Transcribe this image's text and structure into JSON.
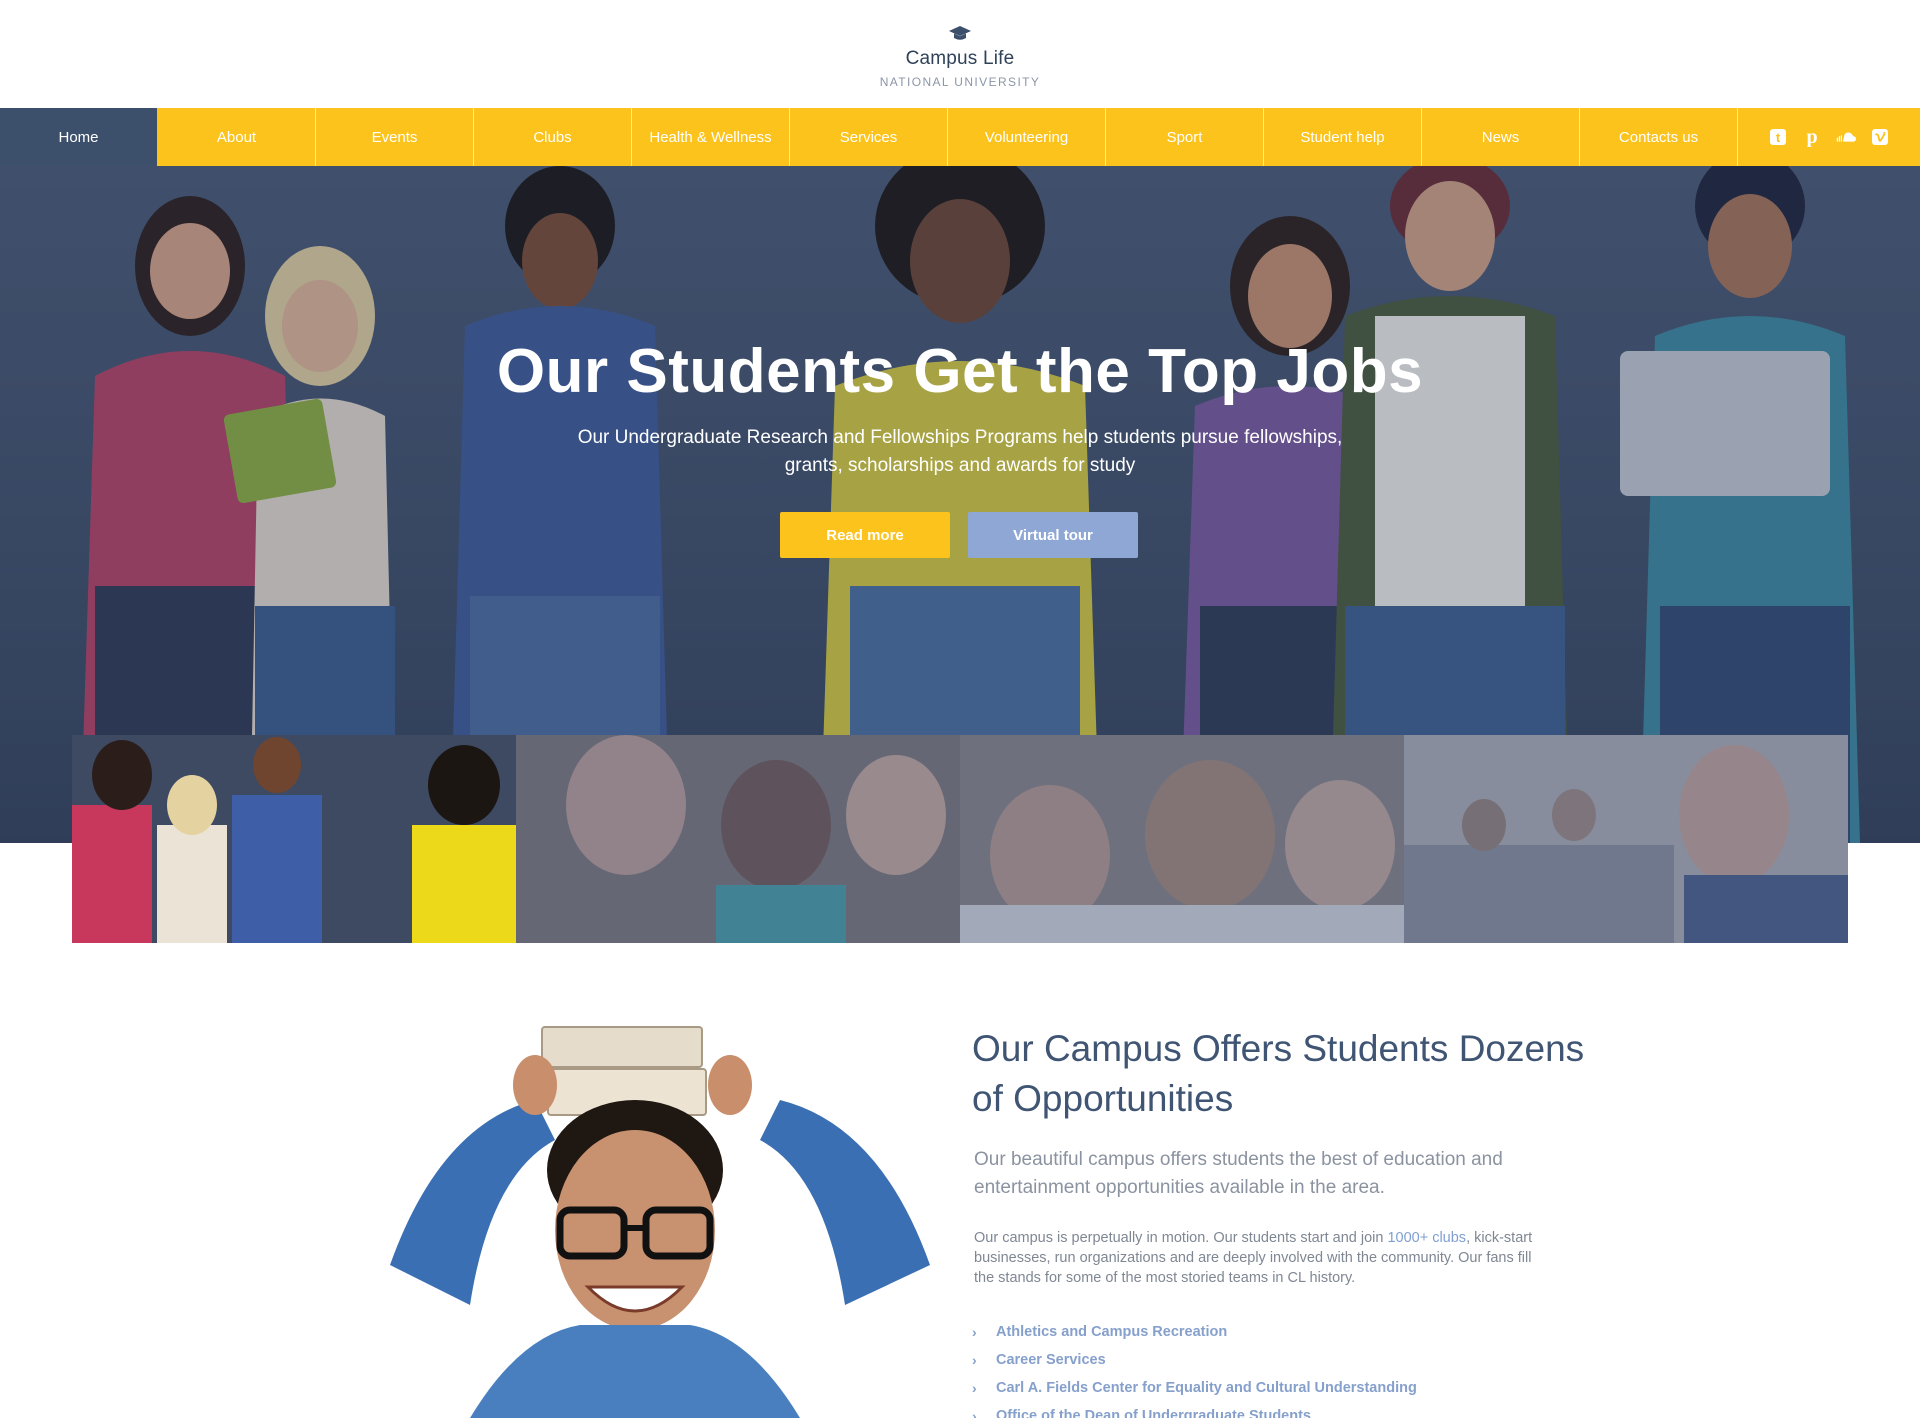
{
  "brand": {
    "title": "Campus Life",
    "subtitle": "NATIONAL UNIVERSITY",
    "icon": "graduation-cap-icon"
  },
  "nav": {
    "items": [
      {
        "label": "Home",
        "active": true
      },
      {
        "label": "About"
      },
      {
        "label": "Events"
      },
      {
        "label": "Clubs"
      },
      {
        "label": "Health & Wellness"
      },
      {
        "label": "Services"
      },
      {
        "label": "Volunteering"
      },
      {
        "label": "Sport"
      },
      {
        "label": "Student help"
      },
      {
        "label": "News"
      },
      {
        "label": "Contacts us"
      }
    ],
    "social": [
      "tumblr-icon",
      "pinterest-icon",
      "soundcloud-icon",
      "vimeo-icon"
    ],
    "accent": "#fcc31c",
    "active_bg": "#3c4f6b"
  },
  "hero": {
    "title": "Our Students Get the Top Jobs",
    "subtitle": "Our Undergraduate Research and Fellowships Programs help students pursue fellowships, grants, scholarships and awards for study",
    "read_more": "Read more",
    "virtual_tour": "Virtual tour"
  },
  "content": {
    "title": "Our Campus Offers Students Dozens of Opportunities",
    "lead": "Our beautiful campus offers students the best of education and entertainment opportunities available in the area.",
    "body_before": "Our campus is perpetually in motion. Our students start and join ",
    "body_link": "1000+ clubs",
    "body_after": ", kick-start businesses, run organizations and are deeply involved with the community. Our fans fill the stands for some of the most storied teams in CL history.",
    "links": [
      "Athletics and Campus Recreation",
      "Career Services",
      "Carl A. Fields Center for Equality and Cultural Understanding",
      "Office of the Dean of Undergraduate Students"
    ]
  }
}
